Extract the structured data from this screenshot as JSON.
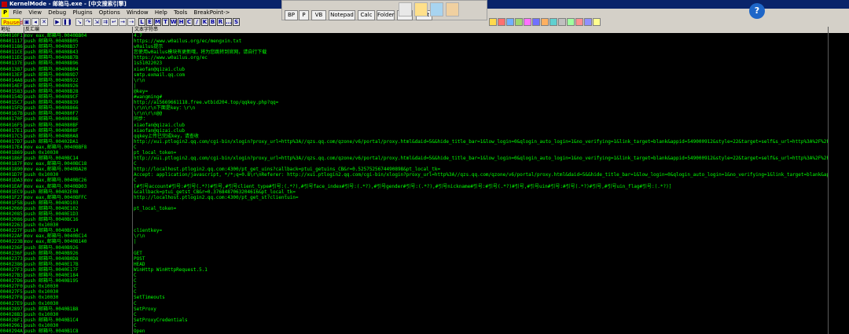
{
  "window": {
    "title": "KernelMode - 邮箱马.exe - [中文搜索引擎]"
  },
  "menubar": {
    "badge": "P",
    "items": [
      "File",
      "View",
      "Debug",
      "Plugins",
      "Options",
      "Window",
      "Help",
      "Tools",
      "BreakPoint->"
    ]
  },
  "toolbar": {
    "status": "Paused",
    "letters": [
      "L",
      "E",
      "M",
      "T",
      "W",
      "H",
      "C",
      "/",
      "K",
      "B",
      "R",
      "...",
      "S"
    ]
  },
  "overlay_buttons": [
    "BP",
    "P",
    "VB",
    "Notepad",
    "Calc",
    "Folder",
    "CMD",
    "Exit"
  ],
  "columns": {
    "address": "地址",
    "disasm": "反汇编",
    "text": "文本字符串"
  },
  "rows": {
    "address": [
      "004010F1",
      "00401117",
      "00401186",
      "004011CE",
      "004011EC",
      "0040137E",
      "00401387",
      "004013EF",
      "004014A8",
      "004014EF",
      "00401583",
      "0040154D",
      "004015C7",
      "004015FD",
      "0040167B",
      "0040170F",
      "004016F5",
      "004017E1",
      "004017C5",
      "004017D7",
      "004017E4",
      "00401869",
      "0040186F",
      "0040187F",
      "00401890",
      "00401D7F",
      "00401DA3",
      "00401EAF",
      "00401EC9",
      "00401F27",
      "00401F5B",
      "00402060",
      "00402085",
      "00402086",
      "00402263",
      "0040227F",
      "004022AF",
      "0040223B",
      "0040236F",
      "0040236F",
      "00402373",
      "00402386",
      "004027F3",
      "004027B3",
      "004027D6",
      "004027F0",
      "004027F5",
      "004027F8",
      "004027E9",
      "00402897",
      "004028B3",
      "004028F1",
      "00402961",
      "0040294A",
      "0040294F",
      "004029C3"
    ],
    "disasm": [
      "mov eax,邮箱马.0040BB04",
      "push 邮箱马.00408B05",
      "push 邮箱马.00408B37",
      "push 邮箱马.00408B43",
      "push 邮箱马.00408B7B",
      "push 邮箱马.00408B96",
      "push 邮箱马.00408B04",
      "push 邮箱马.0040B9D7",
      "push 邮箱马.0040B922",
      "push 邮箱马.00408926",
      "push 邮箱马.00408B28",
      "push 邮箱马.004089CF",
      "push 邮箱马.00408839",
      "push 邮箱马.00408866",
      "push 邮箱马.004080F7",
      "push 邮箱马.00408086",
      "push 邮箱马.004080BF",
      "push 邮箱马.0040B08F",
      "push 邮箱马.0040B0A8",
      "push 邮箱马.00402DA1",
      "mov eax,邮箱马.0040BBF8",
      "push 0x10030",
      "push 邮箱马.0040BC14",
      "mov eax,邮箱马.0040BC18",
      "mov eax,邮箱马.0040BA20",
      "push 0x10030",
      "mov eax,邮箱马.0040BC26",
      "mov eax,邮箱马.0040BD03",
      "push 邮箱马.00402E08",
      "mov eax,邮箱马.0040BFFC",
      "push 邮箱马.0040D103",
      "push 邮箱马.0040E102",
      "push 邮箱马.0040E1D3",
      "push 邮箱马.0040BC16",
      "push 0x10030",
      "push 邮箱马.0040BC14",
      "mov eax,邮箱马.0040BC14",
      "mov eax,邮箱马.0040B140",
      "push 邮箱马.0040B926",
      "push 邮箱马.0040B926",
      "push 邮箱马.0040B0D8",
      "push 邮箱马.0040E17B",
      "push 邮箱马.0040E17F",
      "push 邮箱马.0040E184",
      "push 邮箱马.0040B195",
      "push 0x10030",
      "push 0x10030",
      "push 0x10030",
      "push 0x10030",
      "push 邮箱马.0040B1B8",
      "push 0x10030",
      "push 邮箱马.0040B1C4",
      "push 0x10030",
      "push 邮箱马.0040B1C8",
      "push 0x10030",
      "push 邮箱马.0040B1E1"
    ],
    "text": [
      "4.7",
      "https://www.w0ailus.org/ec/mengxin.txt",
      "w0ailus提示",
      "您使用w0ailus模块有更新哦，将为您跳转到官网，请自行下载",
      "https://www.w0ailus.org/ec",
      "1s51022023",
      "xiaofan@qizai.club",
      "smtp.exmail.qq.com",
      "\\r\\n",
      "|",
      "@key=",
      "#wangming#",
      "http://a15669661118.free.wtbid204.top/qqkey.php?qq=",
      "\\r\\n\\r\\n下面是key：\\r\\n",
      "\\r\\n\\r\\n@@",
      "同步：",
      "xiaofan@qizai.club",
      "xiaofan@qizai.club",
      "qqkey上传已完成key，请查收",
      "http://xui.ptlogin2.qq.com/cgi-bin/xlogin?proxy_url=http%3A//qzs.qq.com/qzone/v6/portal/proxy.html&daid=5&&hide_title_bar=1&low_login=0&qlogin_auto_login=1&no_verifying=1&link_target=blank&appid=549000912&style=22&target=self&s_url=http%3A%2F%2Fqzs.qq.com",
      "C",
      "pt_local_token=",
      "http://xui.ptlogin2.qq.com/cgi-bin/xlogin?proxy_url=http%3A//qzs.qq.com/qzone/v6/portal/proxy.html&daid=5&&hide_title_bar=1&low_login=0&qlogin_auto_login=1&no_verifying=1&link_target=blank&appid=549000912&style=22&target=self&s_url=http%3A%2F%2Fqzs.qq.com",
      "C",
      "http://localhost.ptlogin2.qq.com:4300/pt_get_uins?callback=ptui_getuins_CB&r=0.5257525674490898&pt_local_tk=",
      "Accept: application/javascript, */*;q=0.8\\r\\nReferer: http://xui.ptlogin2.qq.com/cgi-bin/xlogin?proxy_url=http%3A//qzs.qq.com/qzone/v6/portal/proxy.html&daid=5&&hide_title_bar=1&low_login=0&qlogin_auto_login=1&no_verifying=1&link_target=blank&appid=549000912",
      "C",
      "[#引号account#引号:#引号(.*?)#引号,#引号client_type#引号:(.*?),#引号face_index#引号:(.*?),#引号gender#引号:(.*?),#引号nickname#引号:#引号(.*?)#引号,#引号uin#引号:#引号(.*?)#引号,#引号uin_flag#引号:(.*?)]",
      "&callback=ptui_getst_CB&r=0.3768487063204616&pt_local_tk=",
      "http://localhost.ptlogin2.qq.com:4300/pt_get_st?clientuin=",
      "",
      "pt_local_token=",
      "",
      "",
      "",
      "clientkey=",
      "\\r\\n",
      "|",
      "",
      "GET",
      "POST",
      "HEAD",
      "WinHttp WinHttpRequest.5.1",
      "C",
      "C",
      "C",
      "C",
      "SetTimeouts",
      "C",
      "SetProxy",
      "C",
      "SetProxyCredentials",
      "C",
      "Open"
    ]
  }
}
